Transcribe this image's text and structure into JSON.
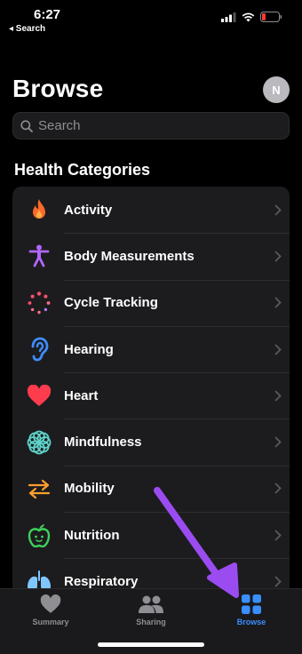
{
  "status": {
    "time": "6:27",
    "back_app": "◂ Search"
  },
  "header": {
    "title": "Browse",
    "avatar_initial": "N"
  },
  "search": {
    "placeholder": "Search"
  },
  "section": {
    "title": "Health Categories"
  },
  "categories": [
    {
      "label": "Activity",
      "icon": "flame-icon",
      "color": "#ff6a2b"
    },
    {
      "label": "Body Measurements",
      "icon": "figure-icon",
      "color": "#b366ff"
    },
    {
      "label": "Cycle Tracking",
      "icon": "cycle-icon",
      "color": "#ff4f6e"
    },
    {
      "label": "Hearing",
      "icon": "ear-icon",
      "color": "#3f8cff"
    },
    {
      "label": "Heart",
      "icon": "heart-icon",
      "color": "#ff3b4e"
    },
    {
      "label": "Mindfulness",
      "icon": "flower-icon",
      "color": "#5fd3c9"
    },
    {
      "label": "Mobility",
      "icon": "arrows-icon",
      "color": "#ff9f2e"
    },
    {
      "label": "Nutrition",
      "icon": "apple-icon",
      "color": "#3fd15a"
    },
    {
      "label": "Respiratory",
      "icon": "lungs-icon",
      "color": "#7fc6ff"
    }
  ],
  "tabs": [
    {
      "label": "Summary",
      "icon": "heart-tab-icon",
      "active": false
    },
    {
      "label": "Sharing",
      "icon": "people-icon",
      "active": false
    },
    {
      "label": "Browse",
      "icon": "grid-icon",
      "active": true
    }
  ],
  "annotation": {
    "arrow_color": "#9b4cf0"
  }
}
